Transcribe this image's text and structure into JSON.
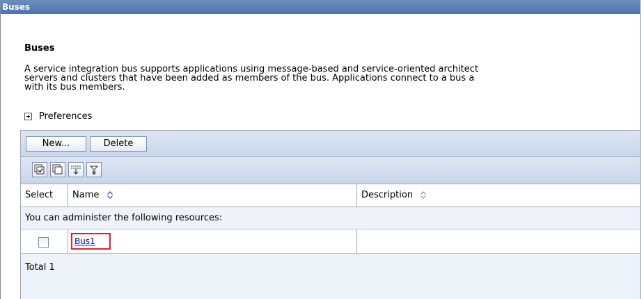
{
  "window": {
    "title": "Buses"
  },
  "heading": "Buses",
  "description_lines": [
    "A service integration bus supports applications using message-based and service-oriented architect",
    "servers and clusters that have been added as members of the bus. Applications connect to a bus a",
    "with its bus members."
  ],
  "preferences": {
    "label": "Preferences",
    "icon": "expand-plus-icon"
  },
  "toolbar": {
    "new_label": "New...",
    "delete_label": "Delete"
  },
  "icon_toolbar": [
    {
      "name": "select-all-icon"
    },
    {
      "name": "deselect-all-icon"
    },
    {
      "name": "show-filter-icon"
    },
    {
      "name": "clear-filter-icon"
    }
  ],
  "table": {
    "columns": {
      "select": "Select",
      "name": "Name",
      "description": "Description"
    },
    "group_label": "You can administer the following resources:",
    "rows": [
      {
        "name": "Bus1",
        "description": ""
      }
    ],
    "total": "Total 1"
  },
  "colors": {
    "titlebar": "#4d72ad",
    "toolbar": "#c9d6ea",
    "link": "#0000cc",
    "highlight": "#e0202a"
  }
}
